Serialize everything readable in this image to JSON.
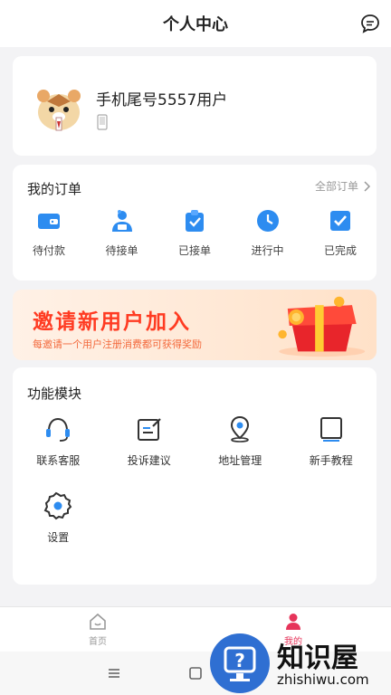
{
  "header": {
    "title": "个人中心",
    "message_icon": "chat-bubble-icon"
  },
  "profile": {
    "username": "手机尾号5557用户",
    "avatar_icon": "hamster-avatar",
    "phone_icon": "phone-icon"
  },
  "orders": {
    "title": "我的订单",
    "all_label": "全部订单",
    "items": [
      {
        "label": "待付款",
        "icon": "wallet-icon",
        "color": "#2d8cf0"
      },
      {
        "label": "待接单",
        "icon": "courier-icon",
        "color": "#2d8cf0"
      },
      {
        "label": "已接单",
        "icon": "clipboard-icon",
        "color": "#2d8cf0"
      },
      {
        "label": "进行中",
        "icon": "clock-icon",
        "color": "#2d8cf0"
      },
      {
        "label": "已完成",
        "icon": "checklist-icon",
        "color": "#2d8cf0"
      }
    ]
  },
  "banner": {
    "title": "邀请新用户加入",
    "subtitle": "每邀请一个用户注册消费都可获得奖励"
  },
  "modules": {
    "title": "功能模块",
    "items": [
      {
        "label": "联系客服",
        "icon": "headset-icon"
      },
      {
        "label": "投诉建议",
        "icon": "edit-note-icon"
      },
      {
        "label": "地址管理",
        "icon": "location-pin-icon"
      },
      {
        "label": "新手教程",
        "icon": "book-icon"
      },
      {
        "label": "设置",
        "icon": "gear-icon"
      }
    ]
  },
  "tabbar": {
    "items": [
      {
        "label": "首页",
        "icon": "home-icon",
        "active": false
      },
      {
        "label": "我的",
        "icon": "person-icon",
        "active": true
      }
    ]
  },
  "watermark": {
    "cn": "知识屋",
    "en": "zhishiwu.com"
  },
  "colors": {
    "accent": "#2d8cf0",
    "active_tab": "#e6345a",
    "banner_text": "#ff3b22"
  }
}
